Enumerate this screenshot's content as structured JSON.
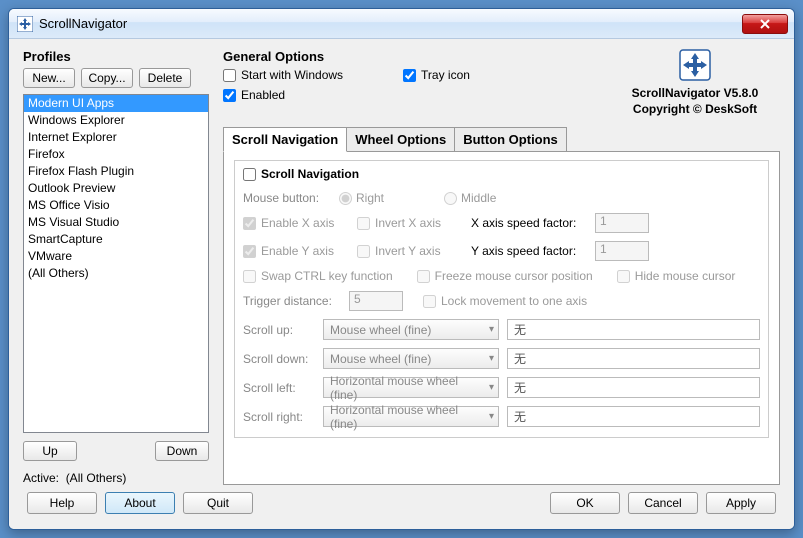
{
  "window": {
    "title": "ScrollNavigator"
  },
  "profiles": {
    "title": "Profiles",
    "new_btn": "New...",
    "copy_btn": "Copy...",
    "delete_btn": "Delete",
    "items": [
      "Modern UI Apps",
      "Windows Explorer",
      "Internet Explorer",
      "Firefox",
      "Firefox Flash Plugin",
      "Outlook Preview",
      "MS Office Visio",
      "MS Visual Studio",
      "SmartCapture",
      "VMware",
      "(All Others)"
    ],
    "selected_index": 0,
    "up_btn": "Up",
    "down_btn": "Down",
    "active_label": "Active:",
    "active_value": "(All Others)"
  },
  "general": {
    "title": "General Options",
    "start_windows": "Start with Windows",
    "enabled": "Enabled",
    "tray_icon": "Tray icon"
  },
  "brand": {
    "line1": "ScrollNavigator V5.8.0",
    "line2": "Copyright © DeskSoft"
  },
  "tabs": {
    "t0": "Scroll Navigation",
    "t1": "Wheel Options",
    "t2": "Button Options",
    "active": 0
  },
  "scroll_nav": {
    "legend": "Scroll Navigation",
    "mouse_button": "Mouse button:",
    "right": "Right",
    "middle": "Middle",
    "enable_x": "Enable X axis",
    "invert_x": "Invert X axis",
    "x_speed_label": "X axis speed factor:",
    "x_speed_value": "1",
    "enable_y": "Enable Y axis",
    "invert_y": "Invert Y axis",
    "y_speed_label": "Y axis speed factor:",
    "y_speed_value": "1",
    "swap_ctrl": "Swap CTRL key function",
    "freeze_cursor": "Freeze mouse cursor position",
    "hide_cursor": "Hide mouse cursor",
    "trigger_label": "Trigger distance:",
    "trigger_value": "5",
    "lock_axis": "Lock movement to one axis",
    "scroll_up": "Scroll up:",
    "scroll_down": "Scroll down:",
    "scroll_left": "Scroll left:",
    "scroll_right": "Scroll right:",
    "wheel_fine": "Mouse wheel (fine)",
    "hwheel_fine": "Horizontal mouse wheel (fine)",
    "none_cn": "无"
  },
  "footer": {
    "help": "Help",
    "about": "About",
    "quit": "Quit",
    "ok": "OK",
    "cancel": "Cancel",
    "apply": "Apply"
  }
}
